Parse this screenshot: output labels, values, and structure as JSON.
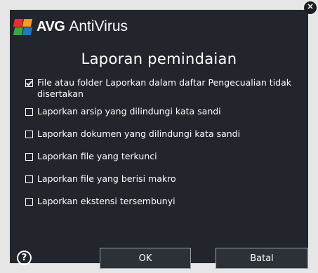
{
  "app": {
    "brand": "AVG",
    "product": "AntiVirus"
  },
  "dialog": {
    "title": "Laporan pemindaian",
    "close_label": "×"
  },
  "options": [
    {
      "label": "File atau folder Laporkan dalam daftar Pengecualian tidak disertakan",
      "checked": true
    },
    {
      "label": "Laporkan arsip yang dilindungi kata sandi",
      "checked": false
    },
    {
      "label": "Laporkan dokumen yang dilindungi kata sandi",
      "checked": false
    },
    {
      "label": "Laporkan file yang terkunci",
      "checked": false
    },
    {
      "label": "Laporkan file yang berisi makro",
      "checked": false
    },
    {
      "label": "Laporkan ekstensi tersembunyi",
      "checked": false
    }
  ],
  "footer": {
    "help_icon": "help-icon",
    "help_glyph": "?",
    "ok_label": "OK",
    "cancel_label": "Batal"
  },
  "colors": {
    "background": "#22262c",
    "frame": "#e6e6e6",
    "text": "#ffffff",
    "logo_red": "#e8312f",
    "logo_orange": "#f59a23",
    "logo_green": "#3ea344",
    "logo_blue": "#2476c2"
  }
}
